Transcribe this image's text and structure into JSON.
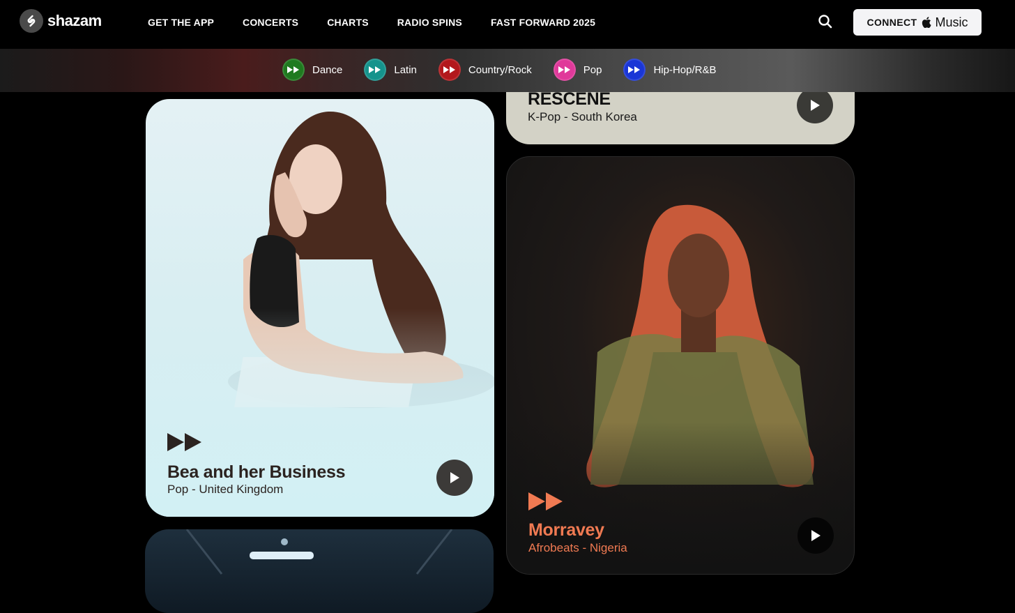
{
  "brand": {
    "name": "shazam"
  },
  "nav": {
    "links": [
      "GET THE APP",
      "CONCERTS",
      "CHARTS",
      "RADIO SPINS",
      "FAST FORWARD 2025"
    ],
    "connect_label": "CONNECT",
    "music_label": "Music"
  },
  "genres": [
    {
      "label": "Dance",
      "color": "#1f7a1f"
    },
    {
      "label": "Latin",
      "color": "#15938c"
    },
    {
      "label": "Country/Rock",
      "color": "#b3181c"
    },
    {
      "label": "Pop",
      "color": "#e0399a"
    },
    {
      "label": "Hip-Hop/R&B",
      "color": "#1a36d6"
    }
  ],
  "cards": {
    "rescene": {
      "name": "RESCENE",
      "meta": "K-Pop - South Korea",
      "accent": "#111111"
    },
    "bea": {
      "name": "Bea and her Business",
      "meta": "Pop - United Kingdom",
      "accent": "#2b2320"
    },
    "morravey": {
      "name": "Morravey",
      "meta": "Afrobeats - Nigeria",
      "accent": "#f07a52"
    }
  }
}
